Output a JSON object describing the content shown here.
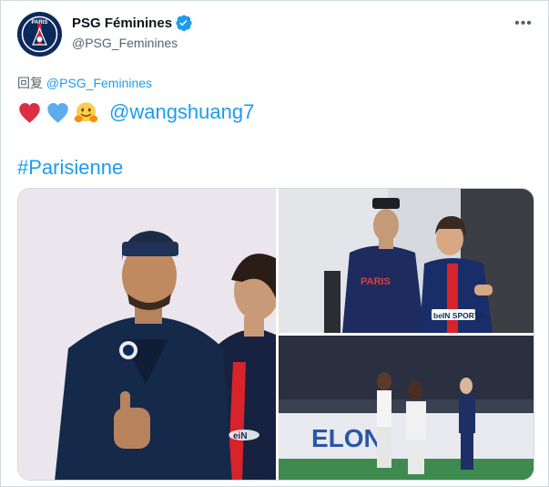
{
  "tweet": {
    "author": {
      "display_name": "PSG Féminines",
      "handle": "@PSG_Feminines",
      "avatar_text": "PARIS"
    },
    "more_label": "•••",
    "reply": {
      "prefix": "回复",
      "handle": "@PSG_Feminines"
    },
    "mention": "@wangshuang7",
    "hashtag": "#Parisienne",
    "emojis": [
      "red-heart",
      "blue-heart",
      "hugging-face"
    ],
    "media": {
      "photo_left": {
        "shirt_text": "eiN"
      },
      "photo_top_right": {
        "shirt_text_1": "PARIS",
        "shirt_text_2": "beIN SPORTS"
      },
      "photo_bottom_right": {
        "board_text": "ELON"
      }
    }
  },
  "colors": {
    "accent": "#1d9bf0",
    "text_secondary": "#536471",
    "psg_navy": "#0b2a5b",
    "psg_red": "#d8232a"
  }
}
